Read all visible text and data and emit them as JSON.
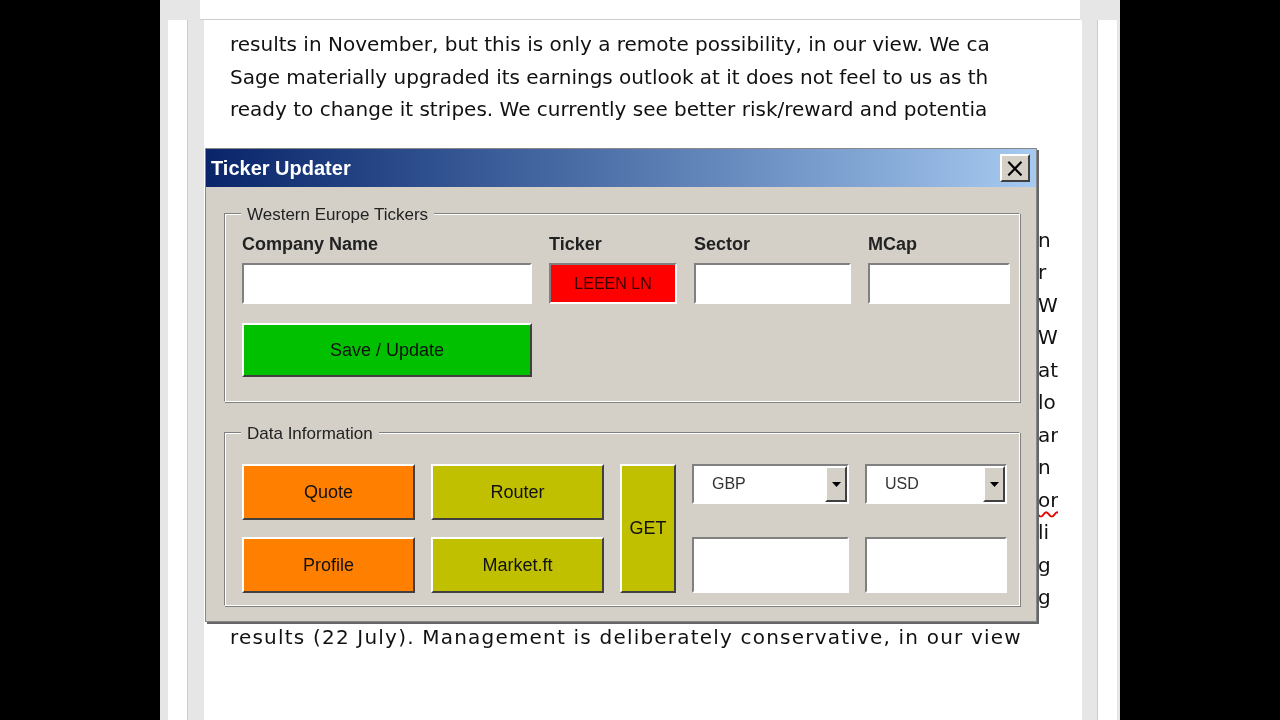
{
  "document": {
    "lines": [
      "results in November, but this is only a remote possibility, in our view. We ca",
      "Sage materially upgraded its earnings outlook at it does not feel to us as th",
      "ready to change it stripes. We currently see better risk/reward and potentia"
    ],
    "edge_fragments": [
      {
        "text": "n",
        "misspelled": false
      },
      {
        "text": "r",
        "misspelled": false
      },
      {
        "text": "W",
        "misspelled": false
      },
      {
        "text": "W",
        "misspelled": false
      },
      {
        "text": "at",
        "misspelled": false
      },
      {
        "text": "lo",
        "misspelled": false
      },
      {
        "text": "ar",
        "misspelled": false
      },
      {
        "text": "n",
        "misspelled": false
      },
      {
        "text": "or",
        "misspelled": true
      },
      {
        "text": "li",
        "misspelled": false
      },
      {
        "text": "g",
        "misspelled": false
      },
      {
        "text": "g",
        "misspelled": false
      }
    ],
    "last_line": "results (22 July). Management is deliberately conservative, in our view"
  },
  "dialog": {
    "title": "Ticker Updater",
    "close": "×",
    "tickers_frame": {
      "legend": "Western Europe Tickers",
      "columns": [
        "Company Name",
        "Ticker",
        "Sector",
        "MCap"
      ],
      "fields": [
        {
          "color": "#ffffff"
        },
        {
          "value": "LEEEN LN",
          "color": "#ff0000"
        },
        {
          "color": "#ffffff"
        },
        {
          "color": "#ffffff"
        }
      ],
      "save_button": {
        "label": "Save / Update",
        "color": "#00c000"
      }
    },
    "data_frame": {
      "legend": "Data Information",
      "buttons": [
        {
          "label": "Quote",
          "color": "#ff8000"
        },
        {
          "label": "Router",
          "color": "#c0c000"
        },
        {
          "label": "Profile",
          "color": "#ff8000"
        },
        {
          "label": "Market.ft",
          "color": "#c0c000"
        }
      ],
      "get_button": {
        "label": "GET",
        "color": "#c0c000"
      },
      "dropdowns": [
        {
          "value": "GBP"
        },
        {
          "value": "USD"
        }
      ],
      "fields": [
        {
          "color": "#ffffff"
        },
        {
          "color": "#ffffff"
        }
      ]
    }
  }
}
